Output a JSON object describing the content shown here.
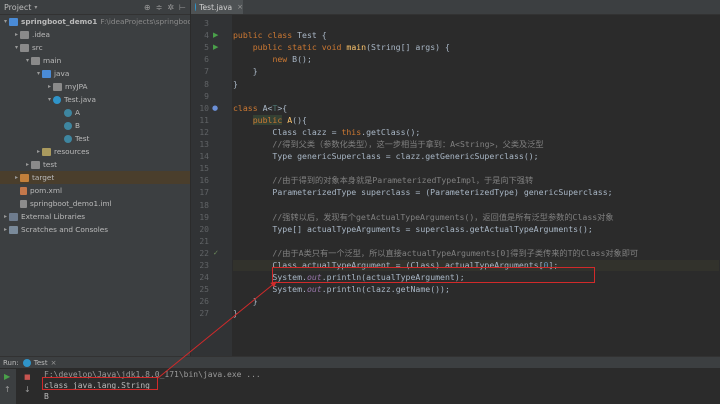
{
  "project_panel": {
    "title": "Project",
    "tree": [
      {
        "label": "springboot_demo1",
        "path": "F:\\ideaProjects\\springboo",
        "bold": true,
        "indent": 0,
        "arrow": "▾",
        "icon": "folder-blue"
      },
      {
        "label": ".idea",
        "indent": 1,
        "arrow": "▸",
        "icon": "folder"
      },
      {
        "label": "src",
        "indent": 1,
        "arrow": "▾",
        "icon": "folder"
      },
      {
        "label": "main",
        "indent": 2,
        "arrow": "▾",
        "icon": "folder"
      },
      {
        "label": "java",
        "indent": 3,
        "arrow": "▾",
        "icon": "folder-blue"
      },
      {
        "label": "myJPA",
        "indent": 4,
        "arrow": "▸",
        "icon": "folder"
      },
      {
        "label": "Test.java",
        "indent": 4,
        "arrow": "▾",
        "icon": "java-file"
      },
      {
        "label": "A",
        "indent": 5,
        "arrow": "",
        "icon": "class"
      },
      {
        "label": "B",
        "indent": 5,
        "arrow": "",
        "icon": "class"
      },
      {
        "label": "Test",
        "indent": 5,
        "arrow": "",
        "icon": "class"
      },
      {
        "label": "resources",
        "indent": 3,
        "arrow": "▸",
        "icon": "folder-res"
      },
      {
        "label": "test",
        "indent": 2,
        "arrow": "▸",
        "icon": "folder"
      },
      {
        "label": "target",
        "indent": 1,
        "arrow": "▸",
        "icon": "folder-orange",
        "target": true
      },
      {
        "label": "pom.xml",
        "indent": 1,
        "arrow": "",
        "icon": "xml"
      },
      {
        "label": "springboot_demo1.iml",
        "indent": 1,
        "arrow": "",
        "icon": "iml"
      },
      {
        "label": "External Libraries",
        "indent": 0,
        "arrow": "▸",
        "icon": "lib"
      },
      {
        "label": "Scratches and Consoles",
        "indent": 0,
        "arrow": "▸",
        "icon": "scratch"
      }
    ]
  },
  "editor": {
    "tab_label": "Test.java",
    "line_numbers": [
      "3",
      "4",
      "5",
      "6",
      "7",
      "8",
      "9",
      "10",
      "11",
      "12",
      "13",
      "14",
      "15",
      "16",
      "17",
      "18",
      "19",
      "20",
      "21",
      "22",
      "23",
      "24",
      "25",
      "26",
      "27"
    ],
    "lines": [
      [],
      [
        {
          "t": "public class ",
          "c": "kw"
        },
        {
          "t": "Test {"
        }
      ],
      [
        {
          "t": "    "
        },
        {
          "t": "public static void ",
          "c": "kw"
        },
        {
          "t": "main",
          "c": "fn"
        },
        {
          "t": "(String[] args) {"
        }
      ],
      [
        {
          "t": "        "
        },
        {
          "t": "new ",
          "c": "kw"
        },
        {
          "t": "B();"
        }
      ],
      [
        {
          "t": "    }"
        }
      ],
      [
        {
          "t": "}"
        }
      ],
      [],
      [
        {
          "t": "class ",
          "c": "kw"
        },
        {
          "t": "A<"
        },
        {
          "t": "T",
          "c": "tp"
        },
        {
          "t": ">{"
        }
      ],
      [
        {
          "t": "    "
        },
        {
          "t": "public",
          "c": "kw",
          "box": true
        },
        {
          "t": " "
        },
        {
          "t": "A",
          "c": "fn"
        },
        {
          "t": "(){"
        }
      ],
      [
        {
          "t": "        Class clazz = "
        },
        {
          "t": "this",
          "c": "kw"
        },
        {
          "t": ".getClass();"
        }
      ],
      [
        {
          "t": "        //得到父类（参数化类型），这一步相当于拿到：A<String>，父类及泛型",
          "c": "cm"
        }
      ],
      [
        {
          "t": "        Type genericSuperclass = clazz.getGenericSuperclass();"
        }
      ],
      [],
      [
        {
          "t": "        //由于得到的对象本身就是ParameterizedTypeImpl，于是向下强转",
          "c": "cm"
        }
      ],
      [
        {
          "t": "        ParameterizedType superclass = (ParameterizedType) genericSuperclass;"
        }
      ],
      [],
      [
        {
          "t": "        //强转以后，发现有个getActualTypeArguments()，返回值是所有泛型参数的Class对象",
          "c": "cm"
        }
      ],
      [
        {
          "t": "        Type[] actualTypeArguments = superclass.getActualTypeArguments();"
        }
      ],
      [],
      [
        {
          "t": "        //由于A类只有一个泛型，所以直接actualTypeArguments[0]得到子类传来的T的Class对象即可",
          "c": "cm"
        }
      ],
      [
        {
          "t": "        Class actualTypeArgument = (Class) actualTypeArguments["
        },
        {
          "t": "0",
          "c": "num"
        },
        {
          "t": "];"
        }
      ],
      [
        {
          "t": "        System."
        },
        {
          "t": "out",
          "c": "it"
        },
        {
          "t": ".println(actualTypeArgument);"
        }
      ],
      [
        {
          "t": "        System."
        },
        {
          "t": "out",
          "c": "it"
        },
        {
          "t": ".println(clazz.getName());"
        }
      ],
      [
        {
          "t": "    }"
        }
      ],
      [
        {
          "t": "}"
        }
      ]
    ]
  },
  "run_panel": {
    "label": "Run:",
    "tab_label": "Test",
    "command": "F:\\develop\\Java\\jdk1.8.0_171\\bin\\java.exe ...",
    "output": [
      "class java.lang.String",
      "B"
    ]
  }
}
